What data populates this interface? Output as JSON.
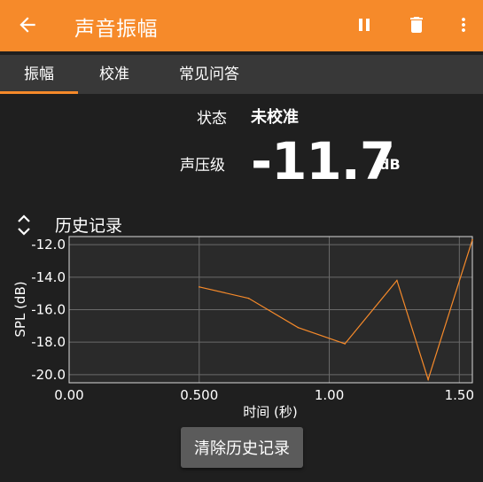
{
  "app_bar": {
    "title": "声音振幅",
    "back_icon": "arrow-left-icon",
    "actions": [
      "pause-icon",
      "trash-icon",
      "more-vert-icon"
    ],
    "color": "#f68a2a"
  },
  "tabs": [
    {
      "label": "振幅",
      "active": true
    },
    {
      "label": "校准",
      "active": false
    },
    {
      "label": "常见问答",
      "active": false
    }
  ],
  "status": {
    "label": "状态",
    "value": "未校准"
  },
  "spl": {
    "label": "声压级",
    "value": "-11.7",
    "unit": "dB"
  },
  "history": {
    "title": "历史记录",
    "clear_button": "清除历史记录"
  },
  "chart_data": {
    "type": "line",
    "xlabel": "时间 (秒)",
    "ylabel": "SPL (dB)",
    "xlim": [
      0,
      1.55
    ],
    "ylim": [
      -20.5,
      -11.5
    ],
    "xticks": [
      0.0,
      0.5,
      1.0,
      1.5
    ],
    "xtick_labels": [
      "0.00",
      "0.500",
      "1.00",
      "1.50"
    ],
    "yticks": [
      -12,
      -14,
      -16,
      -18,
      -20
    ],
    "ytick_labels": [
      "-12.0",
      "-14.0",
      "-16.0",
      "-18.0",
      "-20.0"
    ],
    "grid": true,
    "line_color": "#f68a2a",
    "series": [
      {
        "x": [
          0.5,
          0.69,
          0.88,
          1.06,
          1.26,
          1.38,
          1.55
        ],
        "y": [
          -14.6,
          -15.3,
          -17.1,
          -18.1,
          -14.2,
          -20.3,
          -11.7
        ]
      }
    ]
  }
}
